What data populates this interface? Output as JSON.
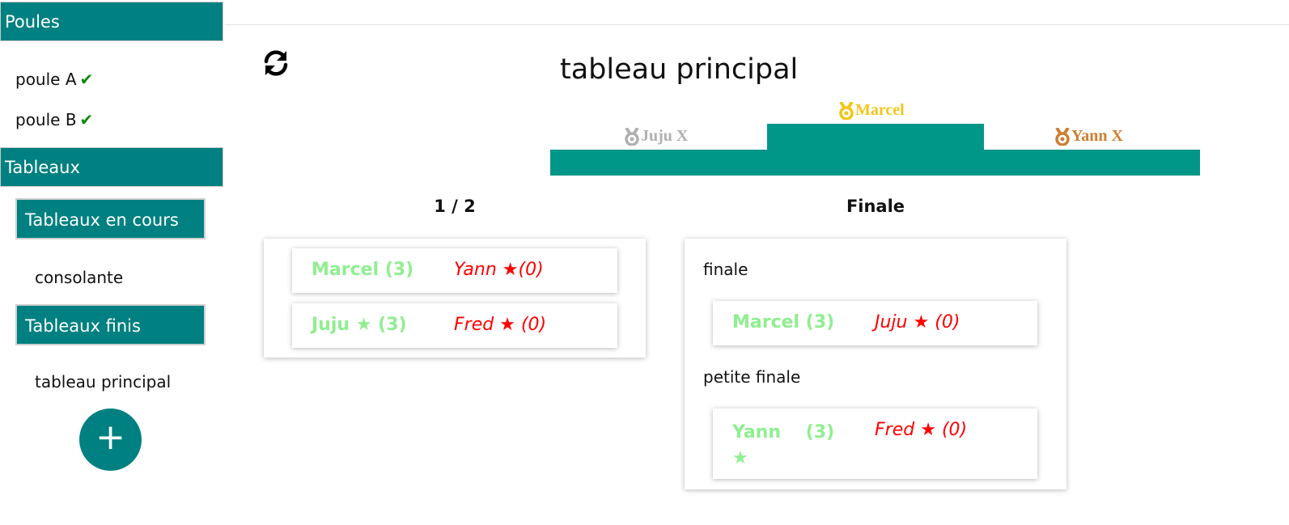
{
  "sidebar": {
    "poules_header": "Poules",
    "poules": [
      {
        "label": "poule A",
        "check": "✔"
      },
      {
        "label": "poule B",
        "check": "✔"
      }
    ],
    "tableaux_header": "Tableaux",
    "en_cours_header": "Tableaux en cours",
    "en_cours": [
      "consolante"
    ],
    "finis_header": "Tableaux finis",
    "finis": [
      "tableau principal"
    ],
    "add_label": "+"
  },
  "main": {
    "title": "tableau principal",
    "podium": {
      "first": "Marcel",
      "second": "Juju X",
      "third": "Yann X"
    },
    "rounds": [
      {
        "title": "1 / 2",
        "matches": [
          {
            "winner": "Marcel",
            "winner_star": "",
            "winner_score": "(3)",
            "loser": "Yann",
            "loser_star": "★",
            "loser_score": "(0)"
          },
          {
            "winner": "Juju",
            "winner_star": "★",
            "winner_score": "(3)",
            "loser": "Fred",
            "loser_star": "★",
            "loser_score": "(0)"
          }
        ]
      },
      {
        "title": "Finale",
        "sections": [
          {
            "label": "finale",
            "winner": "Marcel",
            "winner_star": "",
            "winner_score": "(3)",
            "loser": "Juju",
            "loser_star": "★",
            "loser_score": "(0)"
          },
          {
            "label": "petite finale",
            "winner": "Yann",
            "winner_star": "★",
            "winner_score": "(3)",
            "loser": "Fred",
            "loser_star": "★",
            "loser_score": "(0)"
          }
        ]
      }
    ]
  },
  "colors": {
    "teal": "#008080",
    "podium": "#009688",
    "gold": "#f5c518",
    "silver": "#b0b0b0",
    "bronze": "#cd7f32",
    "winner": "#90ee90",
    "loser": "#ff0000",
    "check": "#0a8a0a"
  }
}
